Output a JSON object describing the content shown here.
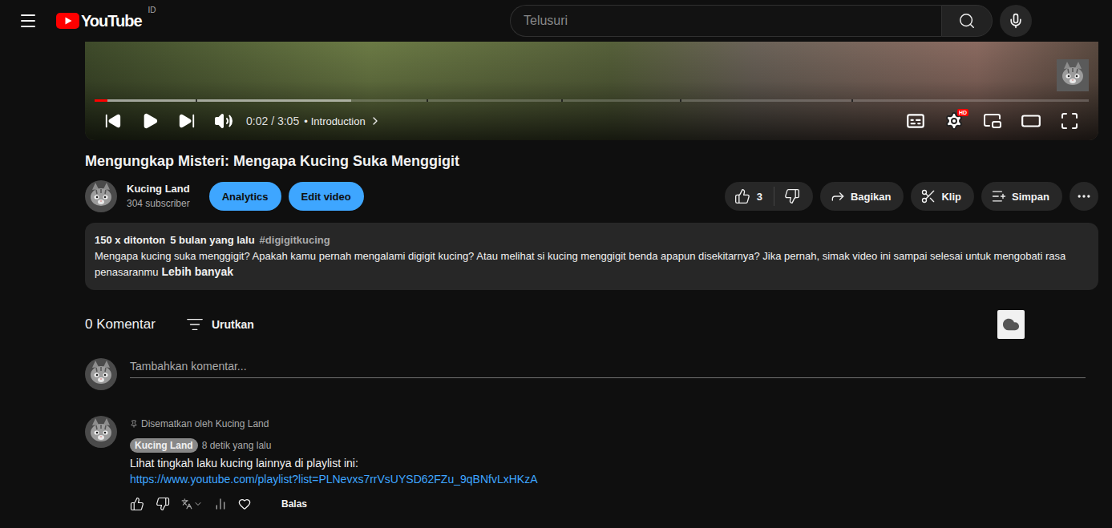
{
  "header": {
    "logo_text": "YouTube",
    "region": "ID",
    "search_placeholder": "Telusuri"
  },
  "player": {
    "played": 0.013,
    "buffered": 0.258,
    "chapter_marks": [
      0.102,
      0.334,
      0.469,
      0.589,
      0.761
    ],
    "time": "0:02 / 3:05",
    "separator": "•",
    "chapter": "Introduction",
    "quality_badge": "HD"
  },
  "video": {
    "title": "Mengungkap Misteri: Mengapa Kucing Suka Menggigit",
    "channel": {
      "name": "Kucing Land",
      "subscribers": "304 subscriber"
    },
    "owner_buttons": [
      "Analytics",
      "Edit video"
    ],
    "likes": "3",
    "actions": [
      "Bagikan",
      "Klip",
      "Simpan"
    ]
  },
  "description": {
    "views": "150 x ditonton",
    "date": "5 bulan yang lalu",
    "hashtag": "#digigitkucing",
    "text": "Mengapa kucing suka menggigit? Apakah kamu pernah mengalami digigit kucing? Atau melihat si kucing menggigit benda apapun disekitarnya? Jika pernah, simak video ini sampai selesai untuk mengobati rasa penasaranmu",
    "more": "Lebih banyak"
  },
  "comments": {
    "count": "0 Komentar",
    "sort": "Urutkan",
    "placeholder": "Tambahkan komentar...",
    "items": [
      {
        "pinned": "Disematkan oleh Kucing Land",
        "author": "Kucing Land",
        "time": "8 detik yang lalu",
        "text": "Lihat tingkah laku kucing lainnya di playlist ini:",
        "link": "https://www.youtube.com/playlist?list=PLNevxs7rrVsUYSD62FZu_9qBNfvLxHKzA",
        "reply": "Balas"
      }
    ]
  }
}
